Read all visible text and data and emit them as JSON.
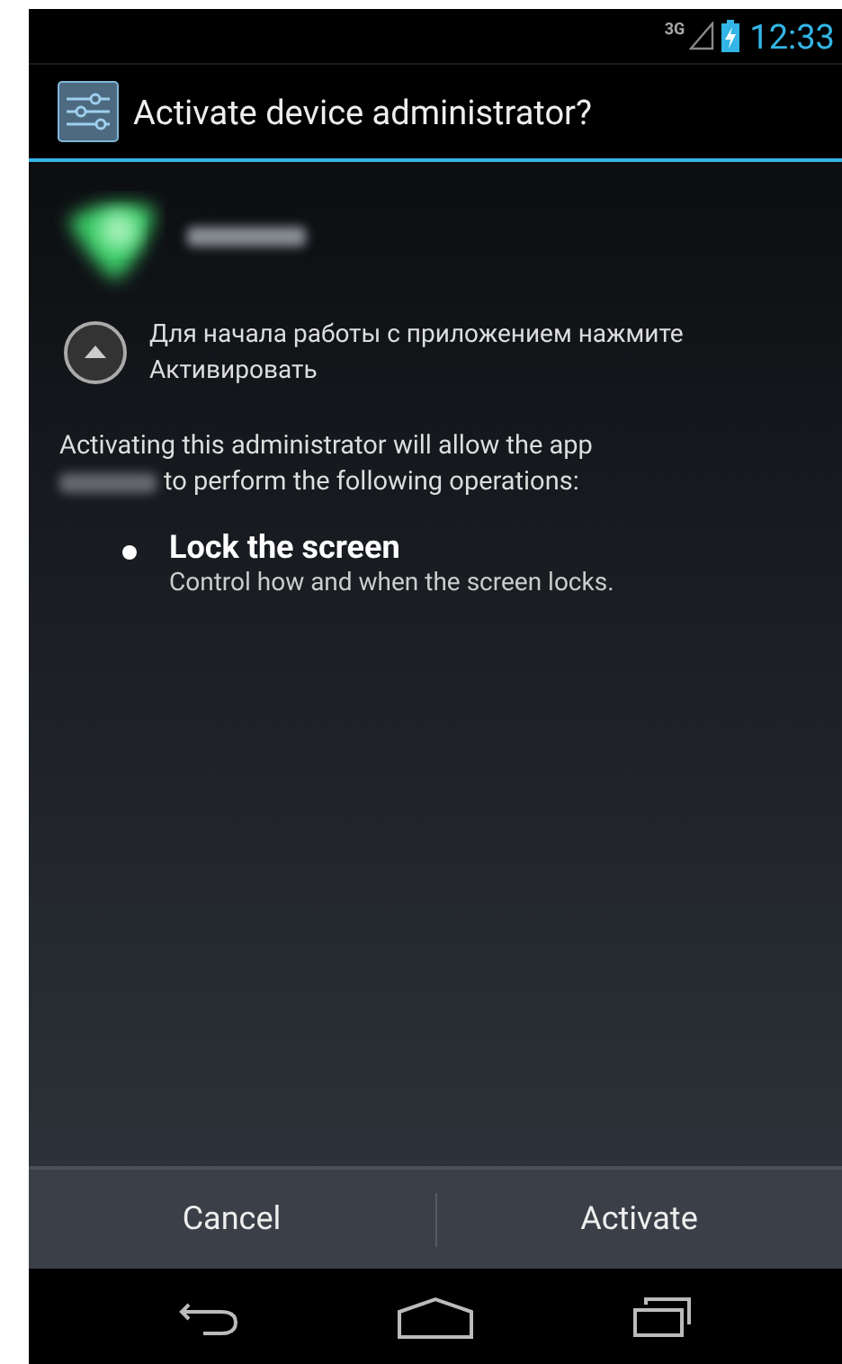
{
  "status_bar": {
    "network": "3G",
    "time": "12:33"
  },
  "dialog": {
    "title": "Activate device administrator?",
    "notice": "Для начала работы с приложением нажмите Активировать",
    "description": [
      "Activating this administrator will allow the app",
      "to perform the following operations:"
    ],
    "policies": [
      {
        "title": "Lock the screen",
        "description": "Control how and when the screen locks."
      }
    ],
    "buttons": [
      "Cancel",
      "Activate"
    ]
  }
}
